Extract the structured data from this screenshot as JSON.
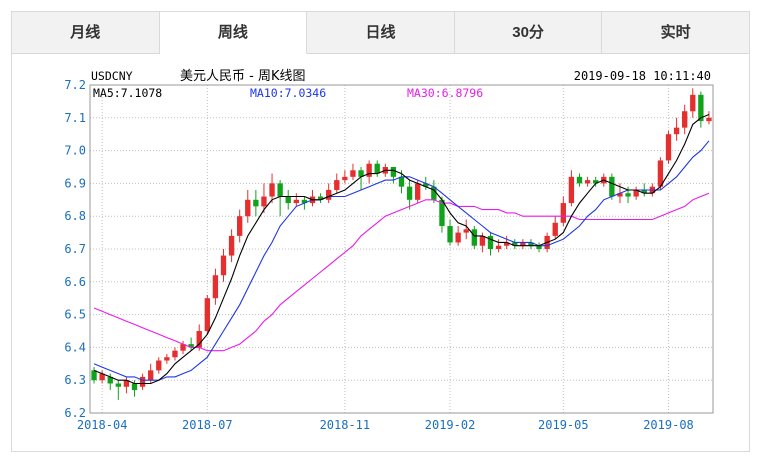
{
  "tabs": [
    {
      "label": "月线",
      "active": false
    },
    {
      "label": "周线",
      "active": true
    },
    {
      "label": "日线",
      "active": false
    },
    {
      "label": "30分",
      "active": false
    },
    {
      "label": "实时",
      "active": false
    }
  ],
  "header": {
    "symbol": "USDCNY",
    "title": "美元人民币 - 周K线图",
    "timestamp": "2019-09-18 10:11:40"
  },
  "indicators": {
    "ma5": "MA5:7.1078",
    "ma10": "MA10:7.0346",
    "ma30": "MA30:6.8796"
  },
  "colors": {
    "up": "#e52f2f",
    "down": "#11a21b",
    "ma5": "#000000",
    "ma10": "#1e37e6",
    "ma30": "#e91ce9",
    "axis_text": "#1a6fc0",
    "grid": "#bfbfbf"
  },
  "chart_data": {
    "type": "candlestick",
    "title": "美元人民币 - 周K线图",
    "ylim": [
      6.2,
      7.2
    ],
    "y_ticks": [
      "6.2",
      "6.3",
      "6.4",
      "6.5",
      "6.6",
      "6.7",
      "6.8",
      "6.9",
      "7.0",
      "7.1",
      "7.2"
    ],
    "x_ticks": [
      {
        "label": "2018-04",
        "index": 1
      },
      {
        "label": "2018-07",
        "index": 14
      },
      {
        "label": "2018-11",
        "index": 31
      },
      {
        "label": "2019-02",
        "index": 44
      },
      {
        "label": "2019-05",
        "index": 58
      },
      {
        "label": "2019-08",
        "index": 71
      }
    ],
    "grid": true,
    "candles": [
      [
        6.33,
        6.3,
        6.34,
        6.29
      ],
      [
        6.3,
        6.32,
        6.33,
        6.29
      ],
      [
        6.31,
        6.29,
        6.32,
        6.27
      ],
      [
        6.29,
        6.28,
        6.3,
        6.24
      ],
      [
        6.28,
        6.3,
        6.31,
        6.26
      ],
      [
        6.29,
        6.27,
        6.3,
        6.25
      ],
      [
        6.28,
        6.31,
        6.32,
        6.27
      ],
      [
        6.3,
        6.33,
        6.35,
        6.29
      ],
      [
        6.33,
        6.36,
        6.37,
        6.32
      ],
      [
        6.36,
        6.37,
        6.38,
        6.35
      ],
      [
        6.37,
        6.39,
        6.4,
        6.36
      ],
      [
        6.39,
        6.41,
        6.42,
        6.38
      ],
      [
        6.41,
        6.4,
        6.43,
        6.39
      ],
      [
        6.4,
        6.45,
        6.47,
        6.39
      ],
      [
        6.45,
        6.55,
        6.56,
        6.44
      ],
      [
        6.55,
        6.62,
        6.64,
        6.53
      ],
      [
        6.62,
        6.68,
        6.7,
        6.6
      ],
      [
        6.68,
        6.74,
        6.76,
        6.66
      ],
      [
        6.74,
        6.8,
        6.82,
        6.72
      ],
      [
        6.8,
        6.85,
        6.88,
        6.78
      ],
      [
        6.85,
        6.83,
        6.88,
        6.8
      ],
      [
        6.83,
        6.86,
        6.9,
        6.81
      ],
      [
        6.86,
        6.9,
        6.93,
        6.84
      ],
      [
        6.9,
        6.86,
        6.91,
        6.8
      ],
      [
        6.86,
        6.84,
        6.88,
        6.82
      ],
      [
        6.84,
        6.85,
        6.87,
        6.83
      ],
      [
        6.85,
        6.84,
        6.86,
        6.82
      ],
      [
        6.84,
        6.86,
        6.88,
        6.83
      ],
      [
        6.86,
        6.85,
        6.87,
        6.84
      ],
      [
        6.85,
        6.88,
        6.9,
        6.84
      ],
      [
        6.88,
        6.91,
        6.93,
        6.87
      ],
      [
        6.91,
        6.92,
        6.94,
        6.9
      ],
      [
        6.92,
        6.94,
        6.96,
        6.91
      ],
      [
        6.94,
        6.92,
        6.95,
        6.88
      ],
      [
        6.92,
        6.96,
        6.97,
        6.9
      ],
      [
        6.96,
        6.93,
        6.97,
        6.92
      ],
      [
        6.93,
        6.95,
        6.96,
        6.92
      ],
      [
        6.95,
        6.92,
        6.95,
        6.9
      ],
      [
        6.92,
        6.89,
        6.94,
        6.87
      ],
      [
        6.89,
        6.85,
        6.91,
        6.82
      ],
      [
        6.85,
        6.9,
        6.91,
        6.84
      ],
      [
        6.9,
        6.89,
        6.92,
        6.88
      ],
      [
        6.89,
        6.85,
        6.91,
        6.84
      ],
      [
        6.85,
        6.77,
        6.86,
        6.75
      ],
      [
        6.77,
        6.72,
        6.79,
        6.71
      ],
      [
        6.72,
        6.75,
        6.77,
        6.71
      ],
      [
        6.75,
        6.76,
        6.79,
        6.73
      ],
      [
        6.76,
        6.71,
        6.77,
        6.7
      ],
      [
        6.71,
        6.74,
        6.75,
        6.69
      ],
      [
        6.74,
        6.7,
        6.75,
        6.68
      ],
      [
        6.7,
        6.71,
        6.73,
        6.69
      ],
      [
        6.71,
        6.72,
        6.74,
        6.7
      ],
      [
        6.72,
        6.71,
        6.73,
        6.7
      ],
      [
        6.71,
        6.72,
        6.73,
        6.7
      ],
      [
        6.72,
        6.71,
        6.73,
        6.7
      ],
      [
        6.71,
        6.7,
        6.72,
        6.69
      ],
      [
        6.7,
        6.74,
        6.75,
        6.69
      ],
      [
        6.74,
        6.78,
        6.8,
        6.73
      ],
      [
        6.78,
        6.84,
        6.86,
        6.77
      ],
      [
        6.84,
        6.92,
        6.94,
        6.83
      ],
      [
        6.92,
        6.9,
        6.93,
        6.89
      ],
      [
        6.9,
        6.91,
        6.92,
        6.89
      ],
      [
        6.91,
        6.9,
        6.92,
        6.89
      ],
      [
        6.9,
        6.92,
        6.93,
        6.89
      ],
      [
        6.92,
        6.86,
        6.93,
        6.85
      ],
      [
        6.86,
        6.87,
        6.9,
        6.84
      ],
      [
        6.87,
        6.86,
        6.89,
        6.84
      ],
      [
        6.86,
        6.88,
        6.89,
        6.85
      ],
      [
        6.88,
        6.87,
        6.9,
        6.86
      ],
      [
        6.87,
        6.89,
        6.9,
        6.86
      ],
      [
        6.89,
        6.97,
        6.98,
        6.88
      ],
      [
        6.97,
        7.05,
        7.06,
        6.96
      ],
      [
        7.05,
        7.07,
        7.1,
        7.03
      ],
      [
        7.07,
        7.12,
        7.14,
        7.05
      ],
      [
        7.12,
        7.17,
        7.19,
        7.1
      ],
      [
        7.17,
        7.09,
        7.18,
        7.07
      ],
      [
        7.09,
        7.1,
        7.12,
        7.08
      ]
    ],
    "ma5": [
      6.33,
      6.32,
      6.31,
      6.3,
      6.3,
      6.29,
      6.29,
      6.29,
      6.3,
      6.32,
      6.35,
      6.37,
      6.39,
      6.41,
      6.44,
      6.49,
      6.55,
      6.61,
      6.68,
      6.74,
      6.78,
      6.82,
      6.85,
      6.86,
      6.86,
      6.86,
      6.86,
      6.85,
      6.85,
      6.86,
      6.87,
      6.88,
      6.9,
      6.92,
      6.93,
      6.93,
      6.94,
      6.94,
      6.93,
      6.91,
      6.9,
      6.89,
      6.88,
      6.85,
      6.81,
      6.78,
      6.77,
      6.74,
      6.74,
      6.73,
      6.72,
      6.72,
      6.71,
      6.71,
      6.71,
      6.71,
      6.72,
      6.73,
      6.75,
      6.8,
      6.84,
      6.87,
      6.9,
      6.91,
      6.9,
      6.89,
      6.88,
      6.88,
      6.87,
      6.87,
      6.89,
      6.93,
      6.97,
      7.02,
      7.08,
      7.1,
      7.11
    ],
    "ma10": [
      6.35,
      6.34,
      6.33,
      6.32,
      6.31,
      6.31,
      6.3,
      6.3,
      6.3,
      6.31,
      6.31,
      6.32,
      6.33,
      6.35,
      6.37,
      6.41,
      6.45,
      6.49,
      6.53,
      6.58,
      6.63,
      6.68,
      6.72,
      6.77,
      6.8,
      6.83,
      6.84,
      6.85,
      6.85,
      6.86,
      6.86,
      6.86,
      6.87,
      6.88,
      6.89,
      6.9,
      6.91,
      6.91,
      6.92,
      6.92,
      6.91,
      6.9,
      6.89,
      6.87,
      6.85,
      6.83,
      6.81,
      6.79,
      6.77,
      6.75,
      6.74,
      6.73,
      6.72,
      6.72,
      6.72,
      6.71,
      6.71,
      6.72,
      6.73,
      6.75,
      6.77,
      6.8,
      6.82,
      6.85,
      6.86,
      6.87,
      6.88,
      6.88,
      6.88,
      6.88,
      6.88,
      6.9,
      6.92,
      6.95,
      6.98,
      7.0,
      7.03
    ],
    "ma30": [
      6.52,
      6.51,
      6.5,
      6.49,
      6.48,
      6.47,
      6.46,
      6.45,
      6.44,
      6.43,
      6.42,
      6.41,
      6.4,
      6.4,
      6.39,
      6.39,
      6.39,
      6.4,
      6.41,
      6.43,
      6.45,
      6.48,
      6.5,
      6.53,
      6.55,
      6.57,
      6.59,
      6.61,
      6.63,
      6.65,
      6.67,
      6.69,
      6.71,
      6.74,
      6.76,
      6.78,
      6.8,
      6.81,
      6.82,
      6.83,
      6.84,
      6.85,
      6.85,
      6.84,
      6.84,
      6.83,
      6.83,
      6.83,
      6.82,
      6.82,
      6.82,
      6.81,
      6.81,
      6.8,
      6.8,
      6.8,
      6.8,
      6.8,
      6.8,
      6.8,
      6.79,
      6.79,
      6.79,
      6.79,
      6.79,
      6.79,
      6.79,
      6.79,
      6.79,
      6.79,
      6.8,
      6.81,
      6.82,
      6.83,
      6.85,
      6.86,
      6.87
    ]
  }
}
